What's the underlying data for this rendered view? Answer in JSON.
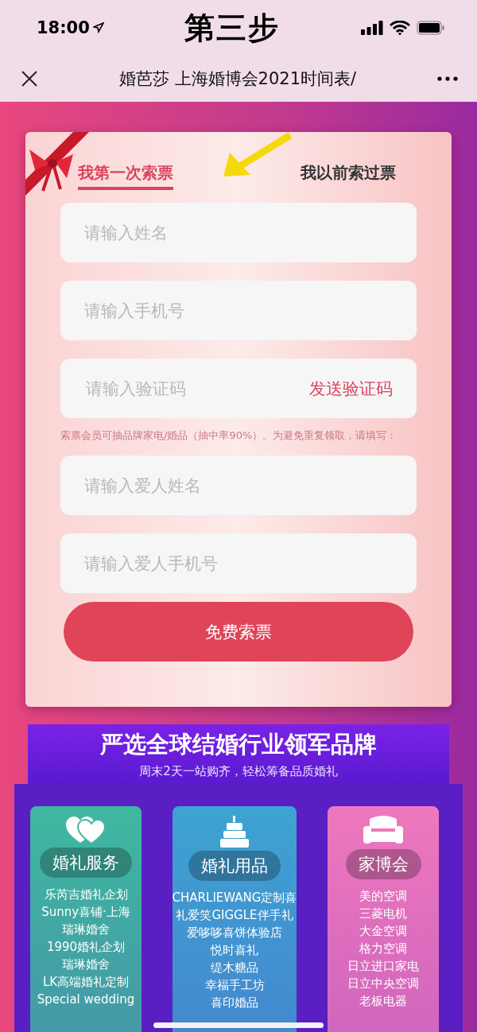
{
  "status_bar": {
    "time": "18:00"
  },
  "overlay_caption": "第三步",
  "nav": {
    "title": "婚芭莎 上海婚博会2021时间表/"
  },
  "tabs": [
    {
      "label": "我第一次索票",
      "selected": true
    },
    {
      "label": "我以前索过票",
      "selected": false
    }
  ],
  "fields_top": [
    {
      "placeholder": "请输入姓名"
    },
    {
      "placeholder": "请输入手机号"
    },
    {
      "placeholder": "请输入验证码",
      "action": "发送验证码"
    }
  ],
  "note": "索票会员可抽品牌家电/婚品（抽中率90%）。为避免重复领取，请填写：",
  "fields_bottom": [
    {
      "placeholder": "请输入爱人姓名"
    },
    {
      "placeholder": "请输入爱人手机号"
    }
  ],
  "submit": "免费索票",
  "banner": {
    "title": "严选全球结婚行业领军品牌",
    "subtitle": "周末2天一站购齐，轻松筹备品质婚礼"
  },
  "categories": [
    {
      "kind": "hearts",
      "title": "婚礼服务",
      "color": "#3fb8a0",
      "items": [
        "乐芮吉婚礼企划",
        "Sunny喜铺·上海",
        "瑞琳婚舍",
        "1990婚礼企划",
        "瑞琳婚舍",
        "LK高端婚礼定制",
        "Special wedding"
      ]
    },
    {
      "kind": "cake",
      "title": "婚礼用品",
      "color": "#3ea3d2",
      "items": [
        "CHARLIEWANG定制喜",
        "礼爱笑GIGGLE伴手礼",
        "爱哆哆喜饼体验店",
        "悦时喜礼",
        "缇木糖品",
        "幸福手工坊",
        "喜印婚品"
      ]
    },
    {
      "kind": "sofa",
      "title": "家博会",
      "color": "#ee78bd",
      "items": [
        "美的空调",
        "三菱电机",
        "大金空调",
        "格力空调",
        "日立进口家电",
        "日立中央空调",
        "老板电器"
      ]
    }
  ]
}
